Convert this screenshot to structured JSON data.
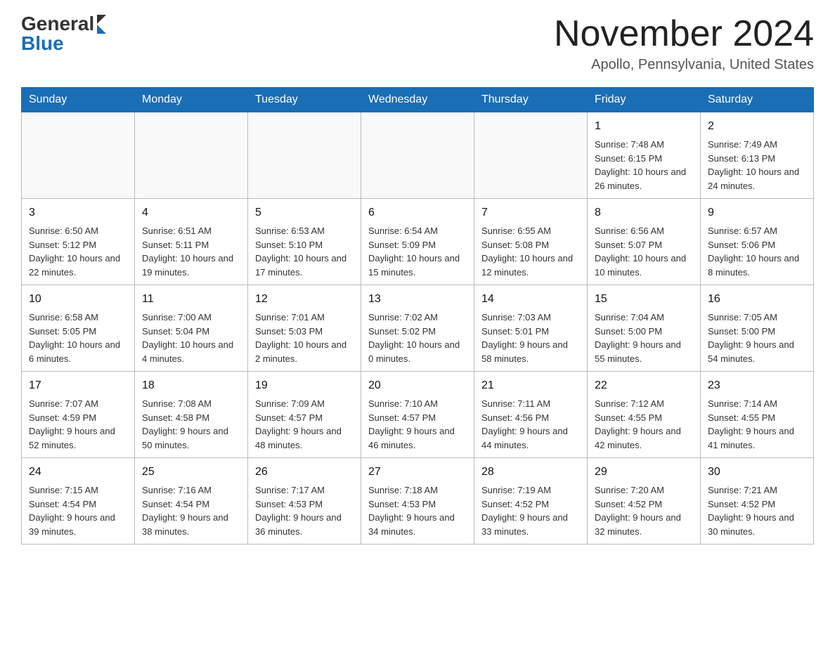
{
  "header": {
    "logo_general": "General",
    "logo_blue": "Blue",
    "month_title": "November 2024",
    "location": "Apollo, Pennsylvania, United States"
  },
  "days_of_week": [
    "Sunday",
    "Monday",
    "Tuesday",
    "Wednesday",
    "Thursday",
    "Friday",
    "Saturday"
  ],
  "weeks": [
    [
      {
        "day": "",
        "info": ""
      },
      {
        "day": "",
        "info": ""
      },
      {
        "day": "",
        "info": ""
      },
      {
        "day": "",
        "info": ""
      },
      {
        "day": "",
        "info": ""
      },
      {
        "day": "1",
        "info": "Sunrise: 7:48 AM\nSunset: 6:15 PM\nDaylight: 10 hours and 26 minutes."
      },
      {
        "day": "2",
        "info": "Sunrise: 7:49 AM\nSunset: 6:13 PM\nDaylight: 10 hours and 24 minutes."
      }
    ],
    [
      {
        "day": "3",
        "info": "Sunrise: 6:50 AM\nSunset: 5:12 PM\nDaylight: 10 hours and 22 minutes."
      },
      {
        "day": "4",
        "info": "Sunrise: 6:51 AM\nSunset: 5:11 PM\nDaylight: 10 hours and 19 minutes."
      },
      {
        "day": "5",
        "info": "Sunrise: 6:53 AM\nSunset: 5:10 PM\nDaylight: 10 hours and 17 minutes."
      },
      {
        "day": "6",
        "info": "Sunrise: 6:54 AM\nSunset: 5:09 PM\nDaylight: 10 hours and 15 minutes."
      },
      {
        "day": "7",
        "info": "Sunrise: 6:55 AM\nSunset: 5:08 PM\nDaylight: 10 hours and 12 minutes."
      },
      {
        "day": "8",
        "info": "Sunrise: 6:56 AM\nSunset: 5:07 PM\nDaylight: 10 hours and 10 minutes."
      },
      {
        "day": "9",
        "info": "Sunrise: 6:57 AM\nSunset: 5:06 PM\nDaylight: 10 hours and 8 minutes."
      }
    ],
    [
      {
        "day": "10",
        "info": "Sunrise: 6:58 AM\nSunset: 5:05 PM\nDaylight: 10 hours and 6 minutes."
      },
      {
        "day": "11",
        "info": "Sunrise: 7:00 AM\nSunset: 5:04 PM\nDaylight: 10 hours and 4 minutes."
      },
      {
        "day": "12",
        "info": "Sunrise: 7:01 AM\nSunset: 5:03 PM\nDaylight: 10 hours and 2 minutes."
      },
      {
        "day": "13",
        "info": "Sunrise: 7:02 AM\nSunset: 5:02 PM\nDaylight: 10 hours and 0 minutes."
      },
      {
        "day": "14",
        "info": "Sunrise: 7:03 AM\nSunset: 5:01 PM\nDaylight: 9 hours and 58 minutes."
      },
      {
        "day": "15",
        "info": "Sunrise: 7:04 AM\nSunset: 5:00 PM\nDaylight: 9 hours and 55 minutes."
      },
      {
        "day": "16",
        "info": "Sunrise: 7:05 AM\nSunset: 5:00 PM\nDaylight: 9 hours and 54 minutes."
      }
    ],
    [
      {
        "day": "17",
        "info": "Sunrise: 7:07 AM\nSunset: 4:59 PM\nDaylight: 9 hours and 52 minutes."
      },
      {
        "day": "18",
        "info": "Sunrise: 7:08 AM\nSunset: 4:58 PM\nDaylight: 9 hours and 50 minutes."
      },
      {
        "day": "19",
        "info": "Sunrise: 7:09 AM\nSunset: 4:57 PM\nDaylight: 9 hours and 48 minutes."
      },
      {
        "day": "20",
        "info": "Sunrise: 7:10 AM\nSunset: 4:57 PM\nDaylight: 9 hours and 46 minutes."
      },
      {
        "day": "21",
        "info": "Sunrise: 7:11 AM\nSunset: 4:56 PM\nDaylight: 9 hours and 44 minutes."
      },
      {
        "day": "22",
        "info": "Sunrise: 7:12 AM\nSunset: 4:55 PM\nDaylight: 9 hours and 42 minutes."
      },
      {
        "day": "23",
        "info": "Sunrise: 7:14 AM\nSunset: 4:55 PM\nDaylight: 9 hours and 41 minutes."
      }
    ],
    [
      {
        "day": "24",
        "info": "Sunrise: 7:15 AM\nSunset: 4:54 PM\nDaylight: 9 hours and 39 minutes."
      },
      {
        "day": "25",
        "info": "Sunrise: 7:16 AM\nSunset: 4:54 PM\nDaylight: 9 hours and 38 minutes."
      },
      {
        "day": "26",
        "info": "Sunrise: 7:17 AM\nSunset: 4:53 PM\nDaylight: 9 hours and 36 minutes."
      },
      {
        "day": "27",
        "info": "Sunrise: 7:18 AM\nSunset: 4:53 PM\nDaylight: 9 hours and 34 minutes."
      },
      {
        "day": "28",
        "info": "Sunrise: 7:19 AM\nSunset: 4:52 PM\nDaylight: 9 hours and 33 minutes."
      },
      {
        "day": "29",
        "info": "Sunrise: 7:20 AM\nSunset: 4:52 PM\nDaylight: 9 hours and 32 minutes."
      },
      {
        "day": "30",
        "info": "Sunrise: 7:21 AM\nSunset: 4:52 PM\nDaylight: 9 hours and 30 minutes."
      }
    ]
  ]
}
